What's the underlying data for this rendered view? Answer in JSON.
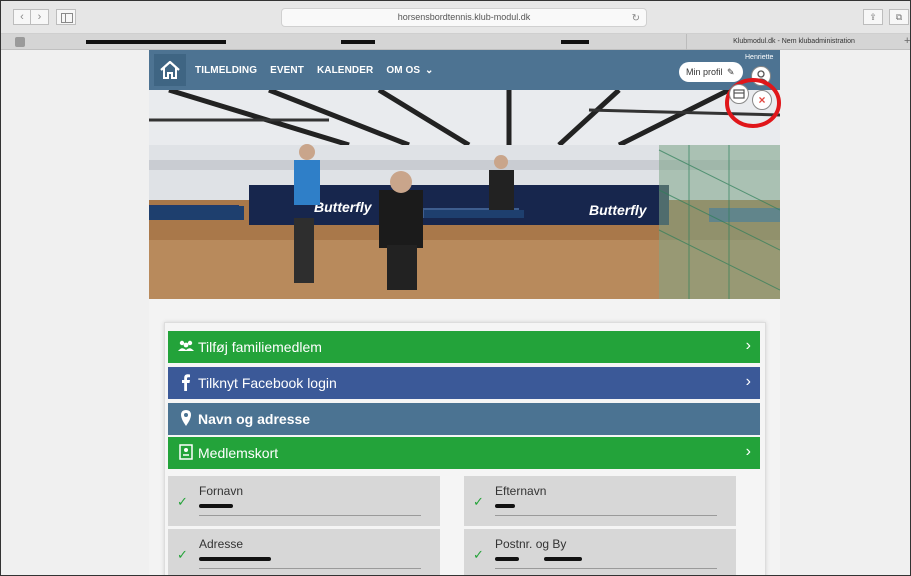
{
  "browser": {
    "url": "horsensbordtennis.klub-modul.dk",
    "tab_title": "Klubmodul.dk - Nem klubadministration",
    "back_symbol": "‹",
    "forward_symbol": "›",
    "reload_symbol": "↻",
    "share_symbol": "⇪",
    "tabs_symbol": "⧉",
    "new_tab_symbol": "+"
  },
  "site": {
    "nav": [
      "TILMELDING",
      "EVENT",
      "KALENDER",
      "OM OS"
    ],
    "om_os_caret": "⌄",
    "profile_button": "Min profil",
    "profile_edit_icon": "✎",
    "user_name": "Henriette",
    "close_symbol": "×"
  },
  "actions": [
    {
      "label": "Tilføj familiemedlem",
      "icon": "family-icon",
      "color": "#23a33a"
    },
    {
      "label": "Tilknyt Facebook login",
      "icon": "facebook-icon",
      "color": "#3b5998"
    },
    {
      "label": "Navn og adresse",
      "icon": "location-pin-icon",
      "color": "#4b7392"
    },
    {
      "label": "Medlemskort",
      "icon": "member-card-icon",
      "color": "#23a33a"
    }
  ],
  "chevron": "›",
  "check": "✓",
  "fields": [
    {
      "label": "Fornavn"
    },
    {
      "label": "Efternavn"
    },
    {
      "label": "Adresse"
    },
    {
      "label": "Postnr. og By"
    }
  ],
  "colors": {
    "nav": "#4d7392",
    "highlight_circle": "#e0161a"
  }
}
